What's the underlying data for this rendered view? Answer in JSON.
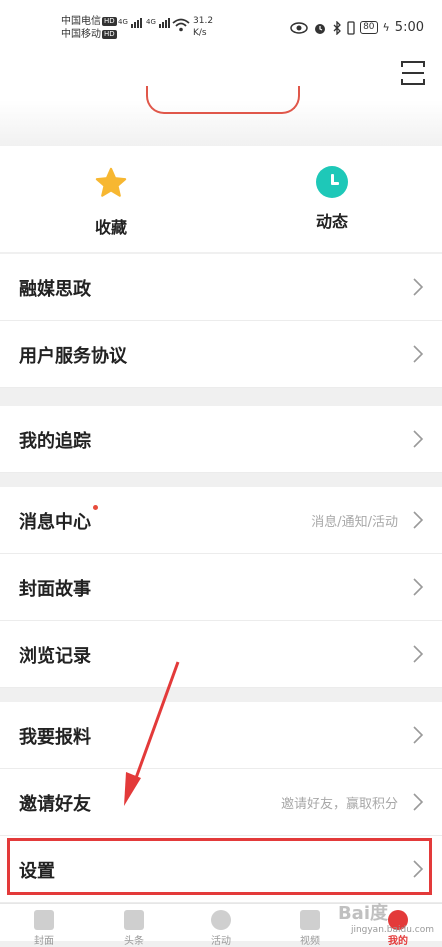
{
  "status_bar": {
    "carrier1": "中国电信",
    "carrier2": "中国移动",
    "hd": "HD",
    "net1": "4G",
    "net2": "4G",
    "speed_value": "31.2",
    "speed_unit": "K/s",
    "battery": "80",
    "time": "5:00"
  },
  "quick": {
    "favorites_label": "收藏",
    "dynamics_label": "动态",
    "star_color": "#f7b731",
    "clock_color": "#1ec8b8"
  },
  "menu": [
    {
      "label": "融媒思政",
      "sub": ""
    },
    {
      "label": "用户服务协议",
      "sub": ""
    },
    {
      "label": "我的追踪",
      "sub": ""
    },
    {
      "label": "消息中心",
      "sub": "消息/通知/活动",
      "dot": true
    },
    {
      "label": "封面故事",
      "sub": ""
    },
    {
      "label": "浏览记录",
      "sub": ""
    },
    {
      "label": "我要报料",
      "sub": ""
    },
    {
      "label": "邀请好友",
      "sub": "邀请好友，赢取积分"
    },
    {
      "label": "设置",
      "sub": ""
    }
  ],
  "bottom_nav": [
    "封面",
    "头条",
    "活动",
    "视频",
    "我的"
  ],
  "watermark": {
    "brand": "Bai度",
    "url": "jingyan.baidu.com"
  },
  "accent_color": "#e33a3a"
}
